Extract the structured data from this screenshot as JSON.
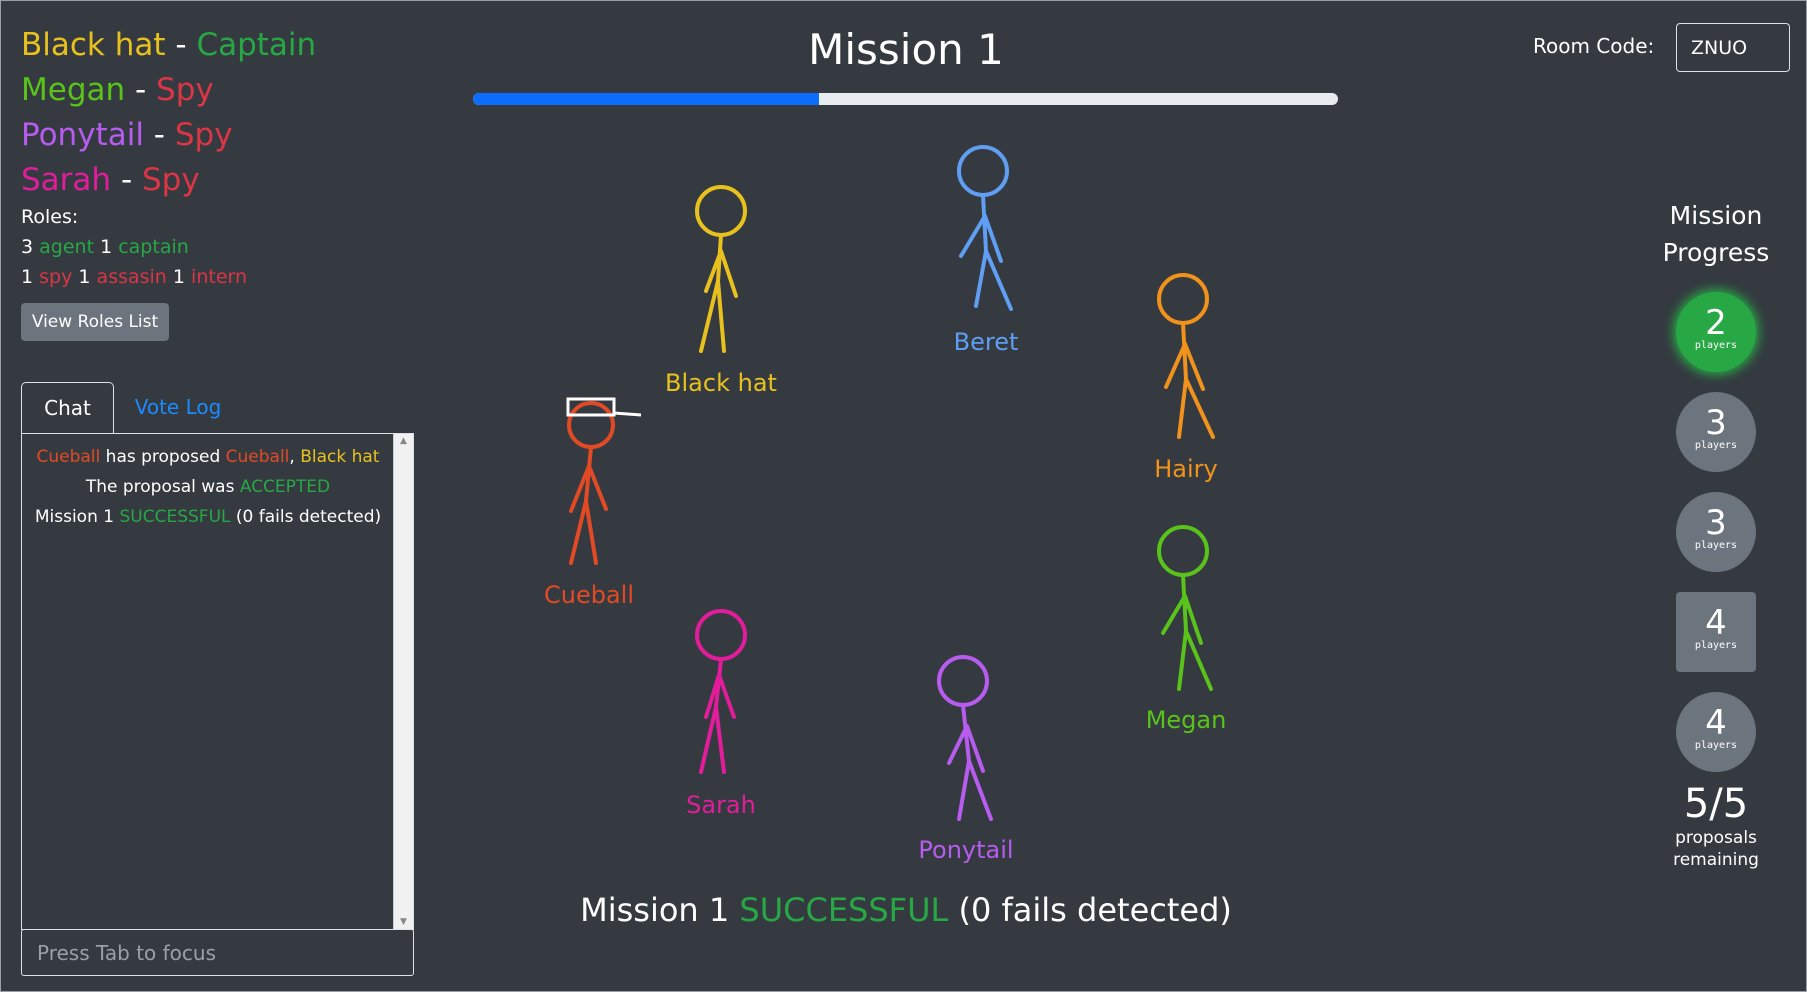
{
  "colors": {
    "accent_blue": "#0d6efd",
    "success_green": "#28a745",
    "spy_red": "#dc3545",
    "black_hat": "#e8c11e",
    "beret": "#5f9ef2",
    "hairy": "#f0921c",
    "megan": "#5ac31b",
    "ponytail": "#b85cf0",
    "sarah": "#e21d9c",
    "cueball": "#e24a26"
  },
  "known_roles": [
    {
      "player": "Black hat",
      "separator": "-",
      "role": "Captain"
    },
    {
      "player": "Megan",
      "separator": "-",
      "role": "Spy"
    },
    {
      "player": "Ponytail",
      "separator": "-",
      "role": "Spy"
    },
    {
      "player": "Sarah",
      "separator": "-",
      "role": "Spy"
    }
  ],
  "roles_summary": {
    "title": "Roles:",
    "good": [
      {
        "count": "3",
        "name": "agent"
      },
      {
        "count": "1",
        "name": "captain"
      }
    ],
    "evil": [
      {
        "count": "1",
        "name": "spy"
      },
      {
        "count": "1",
        "name": "assasin"
      },
      {
        "count": "1",
        "name": "intern"
      }
    ]
  },
  "view_roles_button": "View Roles List",
  "tabs": [
    {
      "label": "Chat"
    },
    {
      "label": "Vote Log"
    }
  ],
  "chat": {
    "lines": [
      {
        "a": "Cueball",
        "b": " has proposed ",
        "c": "Cueball",
        "d": ", ",
        "e": "Black hat"
      },
      {
        "a": "The proposal was ",
        "b": "ACCEPTED"
      },
      {
        "a": "Mission 1 ",
        "b": "SUCCESSFUL",
        "c": " (0 fails detected)"
      }
    ],
    "scroll_up": "▲",
    "scroll_down": "▼",
    "input_placeholder": "Press Tab to focus"
  },
  "mission": {
    "title": "Mission 1",
    "progress": 0.4
  },
  "room": {
    "label": "Room Code:",
    "code": "ZNUO"
  },
  "players": [
    {
      "name": "Black hat",
      "hat": "black-hat"
    },
    {
      "name": "Beret",
      "hat": "beret"
    },
    {
      "name": "Hairy",
      "hat": "none"
    },
    {
      "name": "Cueball",
      "hat": "selected"
    },
    {
      "name": "Megan",
      "hat": "none"
    },
    {
      "name": "Sarah",
      "hat": "none"
    },
    {
      "name": "Ponytail",
      "hat": "none"
    }
  ],
  "mission_progress": {
    "title_line1": "Mission",
    "title_line2": "Progress",
    "missions": [
      {
        "players": "2",
        "label": "players",
        "status": "success",
        "shape": "circle"
      },
      {
        "players": "3",
        "label": "players",
        "status": "pending",
        "shape": "circle"
      },
      {
        "players": "3",
        "label": "players",
        "status": "pending",
        "shape": "circle"
      },
      {
        "players": "4",
        "label": "players",
        "status": "pending",
        "shape": "square"
      },
      {
        "players": "4",
        "label": "players",
        "status": "pending",
        "shape": "circle"
      }
    ],
    "proposals": "5/5",
    "proposals_label_1": "proposals",
    "proposals_label_2": "remaining"
  },
  "result": {
    "a": "Mission 1 ",
    "b": "SUCCESSFUL",
    "c": " (0 fails detected)"
  }
}
